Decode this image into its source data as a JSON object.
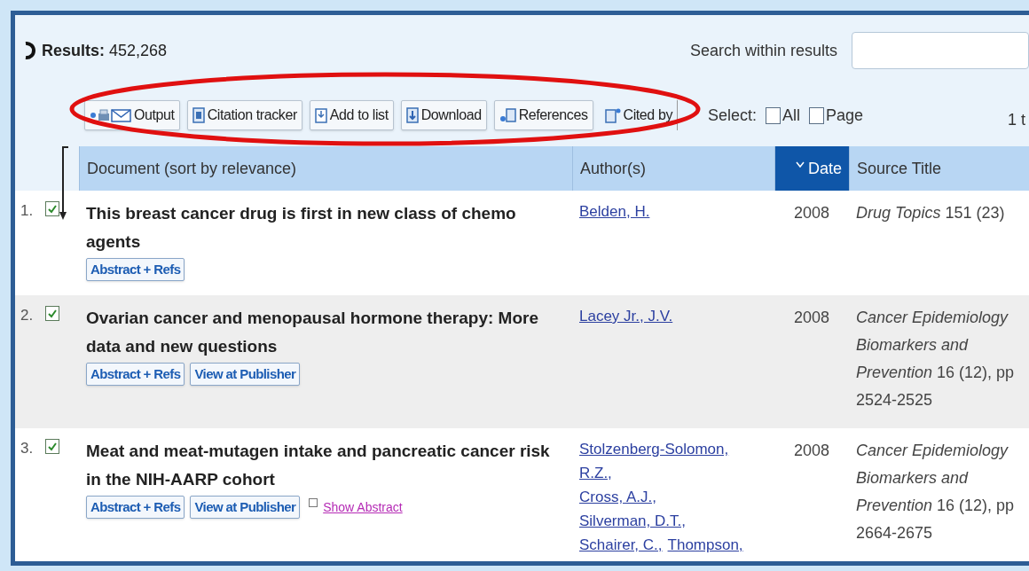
{
  "results": {
    "label": "Results:",
    "count": "452,268"
  },
  "search": {
    "label": "Search within results"
  },
  "toolbar": {
    "buttons": [
      "Output",
      "Citation tracker",
      "Add to list",
      "Download",
      "References",
      "Cited by"
    ],
    "select_label": "Select:",
    "select_options": [
      {
        "label": "All",
        "checked": false
      },
      {
        "label": "Page",
        "checked": false
      }
    ],
    "paging": "1 t"
  },
  "table": {
    "columns": [
      {
        "label": "Document (sort by relevance)",
        "sorted": false
      },
      {
        "label": "Author(s)",
        "sorted": false
      },
      {
        "label": "Date",
        "sorted": true
      },
      {
        "label": "Source Title",
        "sorted": false
      }
    ],
    "rows": [
      {
        "number": "1.",
        "checked": true,
        "title": "This breast cancer drug is first in new class of chemo agents",
        "actions": [
          "Abstract + Refs"
        ],
        "authors": [
          "Belden, H."
        ],
        "date": "2008",
        "source": "*Drug Topics* 151 (23)"
      },
      {
        "number": "2.",
        "checked": true,
        "title": "Ovarian cancer and menopausal hormone therapy: More data and new questions",
        "actions": [
          "Abstract + Refs",
          "View at Publisher"
        ],
        "authors": [
          "Lacey Jr., J.V."
        ],
        "date": "2008",
        "source": "*Cancer Epidemiology Biomarkers and Prevention* 16 (12), pp 2524-2525"
      },
      {
        "number": "3.",
        "checked": true,
        "title": "Meat and meat-mutagen intake and pancreatic cancer risk in the NIH-AARP cohort",
        "actions": [
          "Abstract + Refs",
          "View at Publisher"
        ],
        "show_abstract": "Show Abstract",
        "authors": [
          "Stolzenberg-Solomon, R.Z.,",
          "Cross, A.J.,",
          "Silverman, D.T.,",
          "Schairer, C.,",
          "Thompson,"
        ],
        "date": "2008",
        "source": "*Cancer Epidemiology Biomarkers and Prevention* 16 (12), pp 2664-2675"
      }
    ]
  }
}
